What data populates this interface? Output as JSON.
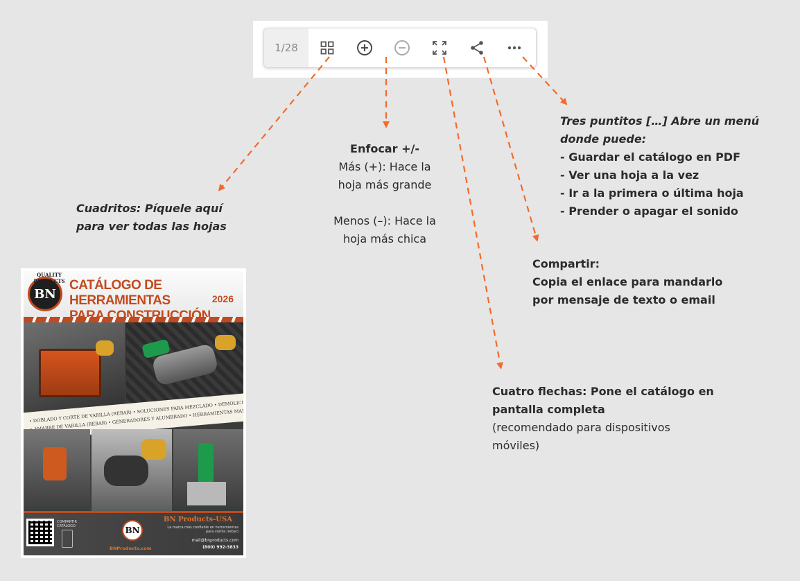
{
  "toolbar": {
    "page_counter": "1/28",
    "buttons": [
      {
        "icon": "grid-icon"
      },
      {
        "icon": "zoom-in-icon"
      },
      {
        "icon": "zoom-out-icon"
      },
      {
        "icon": "fullscreen-icon"
      },
      {
        "icon": "share-icon"
      },
      {
        "icon": "more-icon"
      }
    ]
  },
  "notes": {
    "grid": {
      "lines": [
        "Cuadritos: Píquele aquí",
        "para ver todas las hojas"
      ]
    },
    "zoom": {
      "title": "Enfocar +/-",
      "plus_lines": [
        "Más (+): Hace la",
        "hoja más grande"
      ],
      "minus_lines": [
        "Menos (–): Hace la",
        "hoja más chica"
      ]
    },
    "more": {
      "title_lines": [
        "Tres puntitos […] Abre un menú",
        "donde puede:"
      ],
      "items": [
        "- Guardar el catálogo en PDF",
        "- Ver una hoja a la vez",
        "- Ir a la primera o última hoja",
        "- Prender o apagar el sonido"
      ]
    },
    "share": {
      "lines": [
        "Compartir:",
        "Copia el enlace para mandarlo",
        "por mensaje de texto o email"
      ]
    },
    "fullscreen": {
      "bold_lines": [
        "Cuatro flechas: Pone el catálogo en",
        "pantalla completa"
      ],
      "normal_lines": [
        "(recomendado para dispositivos",
        "móviles)"
      ]
    }
  },
  "cover": {
    "logo_text": "QUALITY PRODUCTS",
    "logo_letters": "BN",
    "title_lines": [
      "CATÁLOGO DE HERRAMIENTAS",
      "PARA CONSTRUCCIÓN"
    ],
    "year": "2026",
    "banner_row_1": "• DOBLADO Y CORTE DE VARILLA (REBAR)   • SOLUCIONES PARA MEZCLADO   • DEMOLICIÓN",
    "banner_row_2": "• AMARRE DE VARILLA (REBAR)   • GENERADORES Y ALUMBRADO   • HERRAMIENTAS MANUALES",
    "qr_label": "COMPARTIR CATÁLOGO",
    "badge_letters": "BN",
    "site": "BNProducts.com",
    "brand": "BN Products-USA",
    "tagline": "La marca más confiable en herramientas para varilla (rebar)",
    "mail": "mail@bnproducts.com",
    "tel": "(800) 992-3833"
  },
  "colors": {
    "accent": "#f26b2d",
    "brand": "#c24a1e",
    "background": "#e6e6e6"
  }
}
